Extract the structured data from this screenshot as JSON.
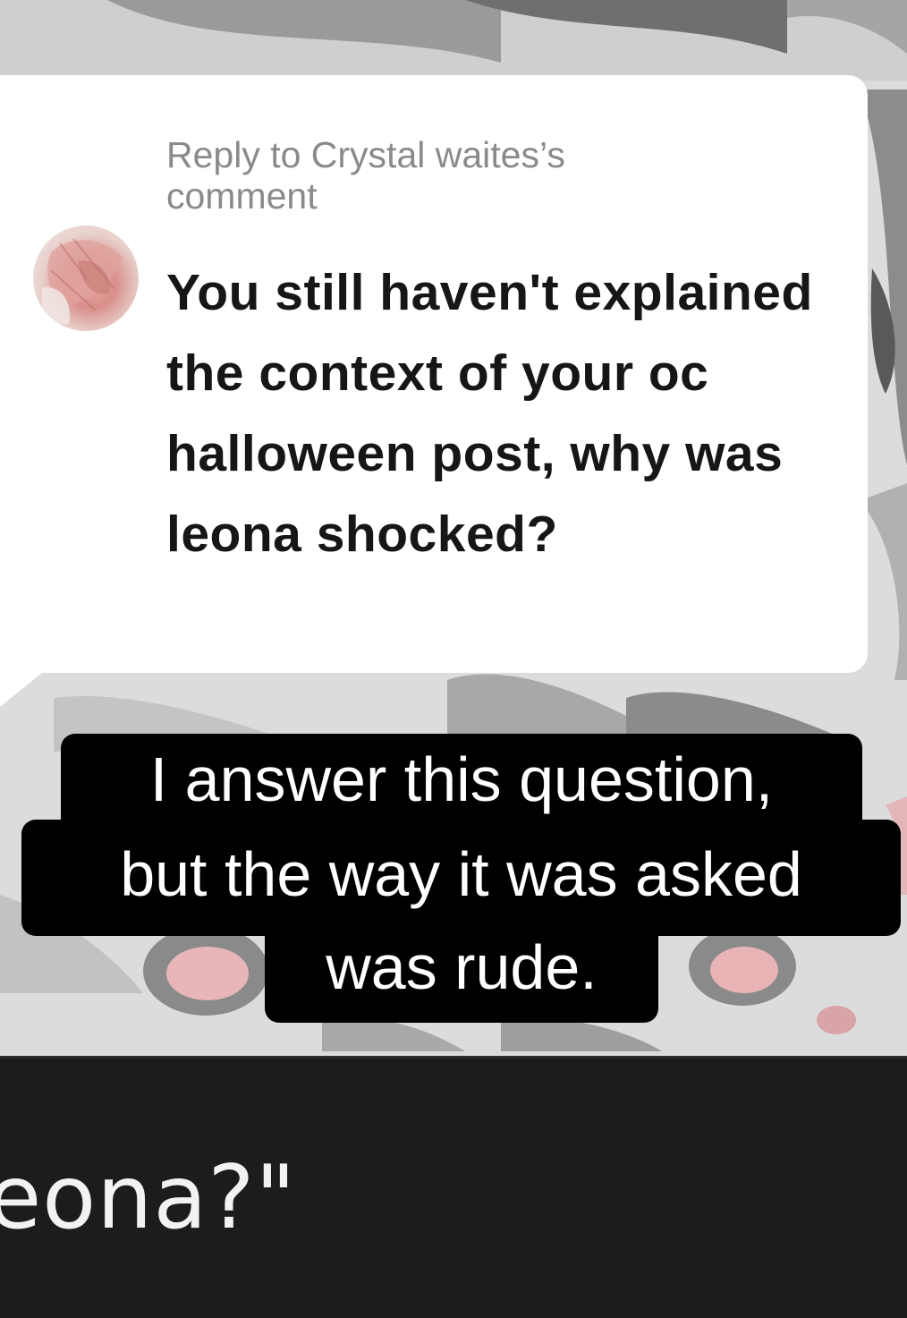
{
  "reply": {
    "header": "Reply to Crystal waites’s comment",
    "comment": "You still haven't explained the context of your oc halloween post, why was leona shocked?"
  },
  "caption": {
    "line1": "I answer this question,",
    "line2": "but the way it was asked",
    "line3": "was rude."
  },
  "background_text": "eona?\"",
  "colors": {
    "bubble": "#ffffff",
    "caption_bg": "#000000",
    "caption_text": "#ffffff",
    "header_text": "#8a8a8a",
    "panel": "#1c1c1c"
  }
}
